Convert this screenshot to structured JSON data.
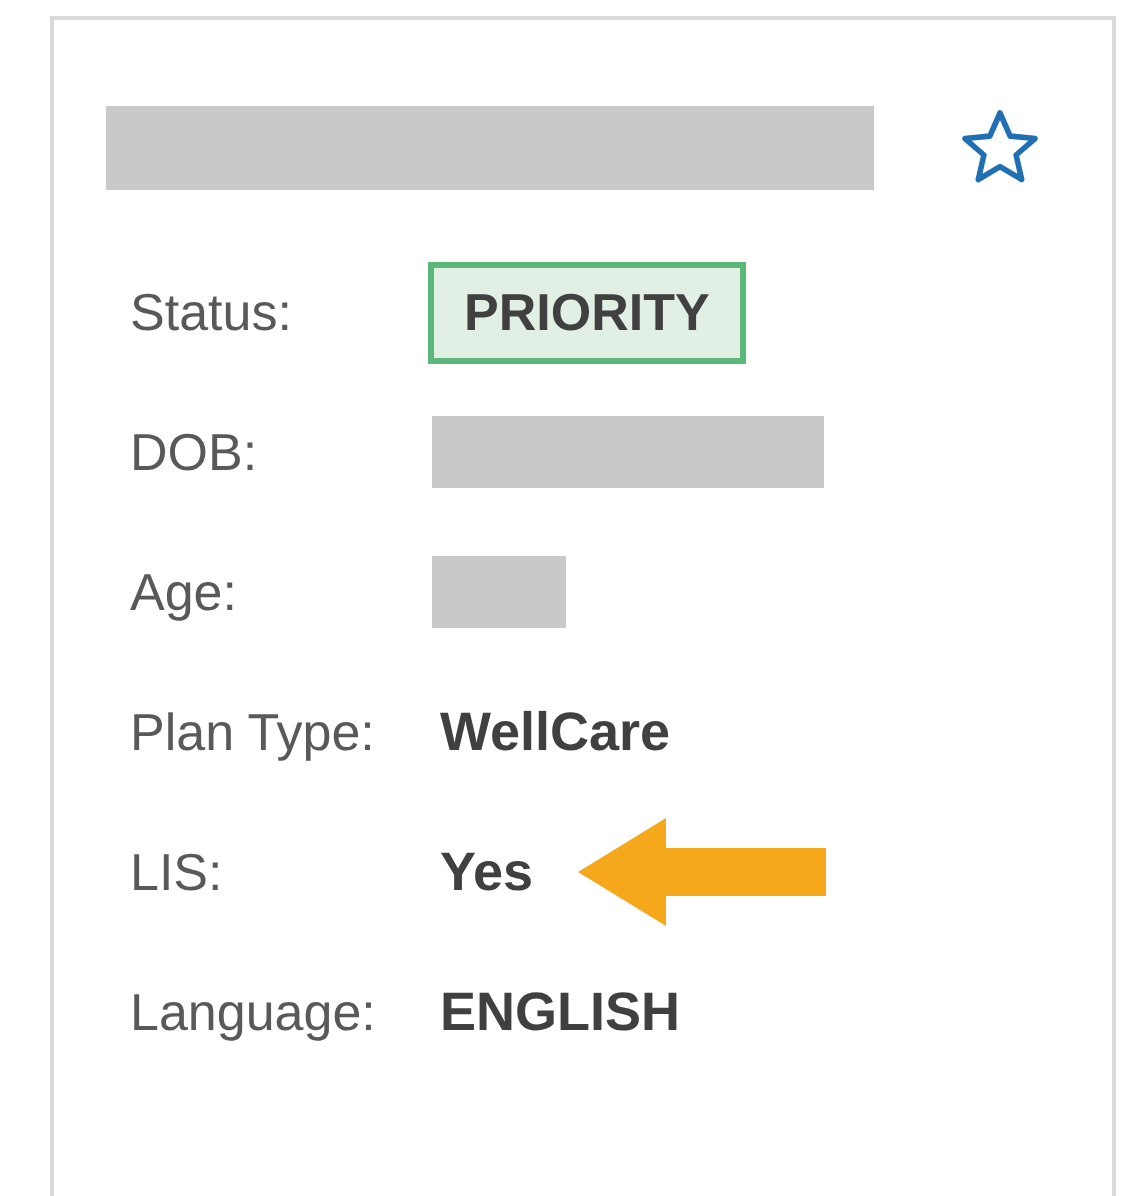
{
  "header": {
    "name_redacted": true,
    "favorite": false
  },
  "fields": [
    {
      "label": "Status:",
      "kind": "badge",
      "value": "PRIORITY"
    },
    {
      "label": "DOB:",
      "kind": "redacted",
      "wide": true
    },
    {
      "label": "Age:",
      "kind": "redacted",
      "wide": false
    },
    {
      "label": "Plan Type:",
      "kind": "text",
      "value": "WellCare"
    },
    {
      "label": "LIS:",
      "kind": "text",
      "value": "Yes",
      "highlighted": true
    },
    {
      "label": "Language:",
      "kind": "text",
      "value": "ENGLISH"
    }
  ]
}
